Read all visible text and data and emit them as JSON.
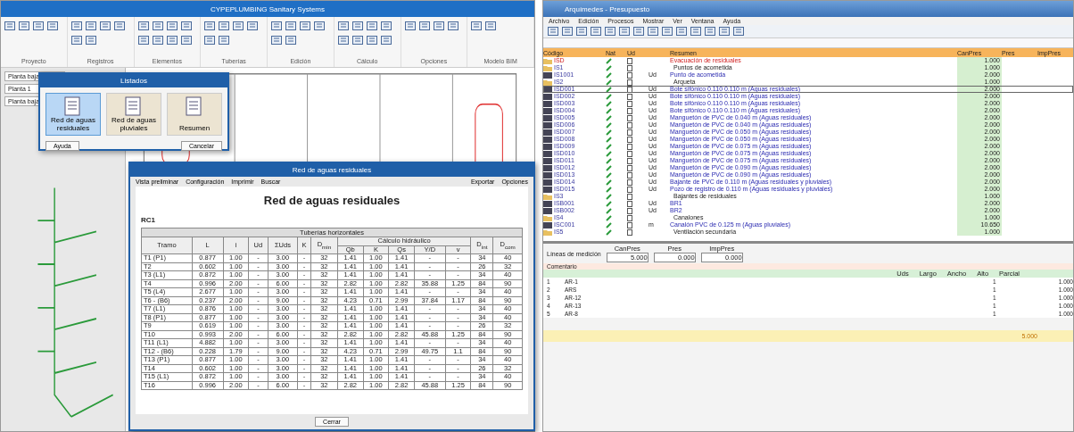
{
  "left_window": {
    "title": "CYPEPLUMBING Sanitary Systems",
    "ribbon_groups": [
      {
        "label": "Proyecto"
      },
      {
        "label": "Registros"
      },
      {
        "label": "Elementos"
      },
      {
        "label": "Tuberías"
      },
      {
        "label": "Edición"
      },
      {
        "label": "Cálculo"
      },
      {
        "label": "Opciones"
      },
      {
        "label": "Modelo BIM"
      }
    ],
    "side_panel": {
      "fields": [
        "Planta baja",
        "Planta 1",
        "Planta baja"
      ]
    },
    "catalog_dialog": {
      "title": "Listados",
      "options": [
        {
          "label": "Red de aguas residuales",
          "selected": true
        },
        {
          "label": "Red de aguas pluviales",
          "selected": false
        },
        {
          "label": "Resumen",
          "selected": false
        }
      ],
      "buttons": [
        "Ayuda",
        "Cancelar"
      ]
    },
    "report_dialog": {
      "title": "Red de aguas residuales",
      "toolbar": [
        "Vista preliminar",
        "Configuración",
        "Imprimir",
        "Buscar"
      ],
      "toolbar_right": [
        "Exportar",
        "Opciones"
      ],
      "heading": "Red de aguas residuales",
      "section": "RC1",
      "table": {
        "caption": "Tuberías horizontales",
        "columns": [
          {
            "label": "Tramo"
          },
          {
            "label": "L"
          },
          {
            "label": "i"
          },
          {
            "label": "Ud"
          },
          {
            "label": "ΣUds"
          },
          {
            "label": "K"
          },
          {
            "label": "D$_{min}$"
          },
          {
            "label": "Cálculo hidráulico",
            "colspan": 5,
            "sub": [
              "Qb",
              "K",
              "Qs",
              "Y/D",
              "v"
            ]
          },
          {
            "label": "D$_{int}$"
          },
          {
            "label": "D$_{com}$"
          }
        ],
        "rows": [
          [
            "T1 (P1)",
            "0.877",
            "1.00",
            "-",
            "3.00",
            "-",
            "32",
            "1.41",
            "1.00",
            "1.41",
            "-",
            "-",
            "34",
            "40"
          ],
          [
            "T2",
            "0.602",
            "1.00",
            "-",
            "3.00",
            "-",
            "32",
            "1.41",
            "1.00",
            "1.41",
            "-",
            "-",
            "26",
            "32"
          ],
          [
            "T3 (L1)",
            "0.872",
            "1.00",
            "-",
            "3.00",
            "-",
            "32",
            "1.41",
            "1.00",
            "1.41",
            "-",
            "-",
            "34",
            "40"
          ],
          [
            "T4",
            "0.996",
            "2.00",
            "-",
            "6.00",
            "-",
            "32",
            "2.82",
            "1.00",
            "2.82",
            "35.88",
            "1.25",
            "84",
            "90"
          ],
          [
            "T5 (L4)",
            "2.677",
            "1.00",
            "-",
            "3.00",
            "-",
            "32",
            "1.41",
            "1.00",
            "1.41",
            "-",
            "-",
            "34",
            "40"
          ],
          [
            "T6 - (B6)",
            "0.237",
            "2.00",
            "-",
            "9.00",
            "-",
            "32",
            "4.23",
            "0.71",
            "2.99",
            "37.84",
            "1.17",
            "84",
            "90"
          ],
          [
            "T7 (L1)",
            "0.876",
            "1.00",
            "-",
            "3.00",
            "-",
            "32",
            "1.41",
            "1.00",
            "1.41",
            "-",
            "-",
            "34",
            "40"
          ],
          [
            "T8 (P1)",
            "0.877",
            "1.00",
            "-",
            "3.00",
            "-",
            "32",
            "1.41",
            "1.00",
            "1.41",
            "-",
            "-",
            "34",
            "40"
          ],
          [
            "T9",
            "0.619",
            "1.00",
            "-",
            "3.00",
            "-",
            "32",
            "1.41",
            "1.00",
            "1.41",
            "-",
            "-",
            "26",
            "32"
          ],
          [
            "T10",
            "0.993",
            "2.00",
            "-",
            "6.00",
            "-",
            "32",
            "2.82",
            "1.00",
            "2.82",
            "45.88",
            "1.25",
            "84",
            "90"
          ],
          [
            "T11 (L1)",
            "4.882",
            "1.00",
            "-",
            "3.00",
            "-",
            "32",
            "1.41",
            "1.00",
            "1.41",
            "-",
            "-",
            "34",
            "40"
          ],
          [
            "T12 - (B6)",
            "0.228",
            "1.79",
            "-",
            "9.00",
            "-",
            "32",
            "4.23",
            "0.71",
            "2.99",
            "49.75",
            "1.1",
            "84",
            "90"
          ],
          [
            "T13 (P1)",
            "0.877",
            "1.00",
            "-",
            "3.00",
            "-",
            "32",
            "1.41",
            "1.00",
            "1.41",
            "-",
            "-",
            "34",
            "40"
          ],
          [
            "T14",
            "0.602",
            "1.00",
            "-",
            "3.00",
            "-",
            "32",
            "1.41",
            "1.00",
            "1.41",
            "-",
            "-",
            "26",
            "32"
          ],
          [
            "T15 (L1)",
            "0.872",
            "1.00",
            "-",
            "3.00",
            "-",
            "32",
            "1.41",
            "1.00",
            "1.41",
            "-",
            "-",
            "34",
            "40"
          ],
          [
            "T16",
            "0.996",
            "2.00",
            "-",
            "6.00",
            "-",
            "32",
            "2.82",
            "1.00",
            "2.82",
            "45.88",
            "1.25",
            "84",
            "90"
          ]
        ]
      },
      "close_button": "Cerrar"
    }
  },
  "right_window": {
    "title": "Arquímedes - Presupuesto",
    "menu": [
      "Archivo",
      "Edición",
      "Procesos",
      "Mostrar",
      "Ver",
      "Ventana",
      "Ayuda"
    ],
    "columns": [
      "Código",
      "Nat",
      "Ud",
      "Resumen",
      "CanPres",
      "Pres",
      "ImpPres"
    ],
    "rows": [
      {
        "kind": "chapter",
        "code": "ISD",
        "unit": "",
        "summary": "Evacuación de residuales",
        "quantity": "1.000",
        "selected": false
      },
      {
        "kind": "folder",
        "code": "IS1",
        "unit": "",
        "summary": "Puntos de acometida",
        "quantity": "1.000",
        "selected": false
      },
      {
        "kind": "item",
        "code": "IS1001",
        "unit": "Ud",
        "summary": "Punto de acometida",
        "quantity": "2.000",
        "selected": false
      },
      {
        "kind": "folder",
        "code": "IS2",
        "unit": "",
        "summary": "Arqueta",
        "quantity": "1.000",
        "selected": false
      },
      {
        "kind": "item",
        "code": "ISD001",
        "unit": "Ud",
        "summary": "Bote sifónico 0.110 0.110 m (Aguas residuales)",
        "quantity": "2.000",
        "selected": true
      },
      {
        "kind": "item",
        "code": "ISD002",
        "unit": "Ud",
        "summary": "Bote sifónico 0.110 0.110 m (Aguas residuales)",
        "quantity": "2.000",
        "selected": false
      },
      {
        "kind": "item",
        "code": "ISD003",
        "unit": "Ud",
        "summary": "Bote sifónico 0.110 0.110 m (Aguas residuales)",
        "quantity": "2.000",
        "selected": false
      },
      {
        "kind": "item",
        "code": "ISD004",
        "unit": "Ud",
        "summary": "Bote sifónico 0.110 0.110 m (Aguas residuales)",
        "quantity": "2.000",
        "selected": false
      },
      {
        "kind": "item",
        "code": "ISD005",
        "unit": "Ud",
        "summary": "Manguetón de PVC de 0.040 m (Aguas residuales)",
        "quantity": "2.000",
        "selected": false
      },
      {
        "kind": "item",
        "code": "ISD006",
        "unit": "Ud",
        "summary": "Manguetón de PVC de 0.040 m (Aguas residuales)",
        "quantity": "2.000",
        "selected": false
      },
      {
        "kind": "item",
        "code": "ISD007",
        "unit": "Ud",
        "summary": "Manguetón de PVC de 0.050 m (Aguas residuales)",
        "quantity": "2.000",
        "selected": false
      },
      {
        "kind": "item",
        "code": "ISD008",
        "unit": "Ud",
        "summary": "Manguetón de PVC de 0.050 m (Aguas residuales)",
        "quantity": "2.000",
        "selected": false
      },
      {
        "kind": "item",
        "code": "ISD009",
        "unit": "Ud",
        "summary": "Manguetón de PVC de 0.075 m (Aguas residuales)",
        "quantity": "2.000",
        "selected": false
      },
      {
        "kind": "item",
        "code": "ISD010",
        "unit": "Ud",
        "summary": "Manguetón de PVC de 0.075 m (Aguas residuales)",
        "quantity": "2.000",
        "selected": false
      },
      {
        "kind": "item",
        "code": "ISD011",
        "unit": "Ud",
        "summary": "Manguetón de PVC de 0.075 m (Aguas residuales)",
        "quantity": "2.000",
        "selected": false
      },
      {
        "kind": "item",
        "code": "ISD012",
        "unit": "Ud",
        "summary": "Manguetón de PVC de 0.090 m (Aguas residuales)",
        "quantity": "2.000",
        "selected": false
      },
      {
        "kind": "item",
        "code": "ISD013",
        "unit": "Ud",
        "summary": "Manguetón de PVC de 0.090 m (Aguas residuales)",
        "quantity": "2.000",
        "selected": false
      },
      {
        "kind": "item",
        "code": "ISD014",
        "unit": "Ud",
        "summary": "Bajante de PVC de 0.110 m (Aguas residuales y pluviales)",
        "quantity": "2.000",
        "selected": false
      },
      {
        "kind": "item",
        "code": "ISD015",
        "unit": "Ud",
        "summary": "Pozo de registro de 0.110 m (Aguas residuales y pluviales)",
        "quantity": "2.000",
        "selected": false
      },
      {
        "kind": "folder",
        "code": "IS3",
        "unit": "",
        "summary": "Bajantes de residuales",
        "quantity": "1.000",
        "selected": false
      },
      {
        "kind": "item",
        "code": "ISB001",
        "unit": "Ud",
        "summary": "BR1",
        "quantity": "2.000",
        "selected": false
      },
      {
        "kind": "item",
        "code": "ISB002",
        "unit": "Ud",
        "summary": "BR2",
        "quantity": "2.000",
        "selected": false
      },
      {
        "kind": "folder",
        "code": "IS4",
        "unit": "",
        "summary": "Canalones",
        "quantity": "1.000",
        "selected": false
      },
      {
        "kind": "item",
        "code": "ISC001",
        "unit": "m",
        "summary": "Canalón PVC de 0.125 m (Aguas pluviales)",
        "quantity": "10.650",
        "selected": false
      },
      {
        "kind": "folder",
        "code": "IS5",
        "unit": "",
        "summary": "Ventilación secundaria",
        "quantity": "1.000",
        "selected": false
      }
    ],
    "lower_panel": {
      "title": "Líneas de medición",
      "fields": [
        {
          "label": "CanPres",
          "value": "5.000"
        },
        {
          "label": "Pres",
          "value": "0.000"
        },
        {
          "label": "ImpPres",
          "value": "0.000"
        }
      ],
      "header": "Comentario",
      "columns": [
        "Uds",
        "Largo",
        "Ancho",
        "Alto",
        "Parcial"
      ],
      "rows": [
        {
          "index": "1",
          "comment": "AR-1",
          "uds": "1",
          "total": "1.000"
        },
        {
          "index": "2",
          "comment": "ARS",
          "uds": "1",
          "total": "1.000"
        },
        {
          "index": "3",
          "comment": "AR-12",
          "uds": "1",
          "total": "1.000"
        },
        {
          "index": "4",
          "comment": "AR-13",
          "uds": "1",
          "total": "1.000"
        },
        {
          "index": "5",
          "comment": "AR-8",
          "uds": "1",
          "total": "1.000"
        }
      ],
      "total": "5.000"
    }
  }
}
